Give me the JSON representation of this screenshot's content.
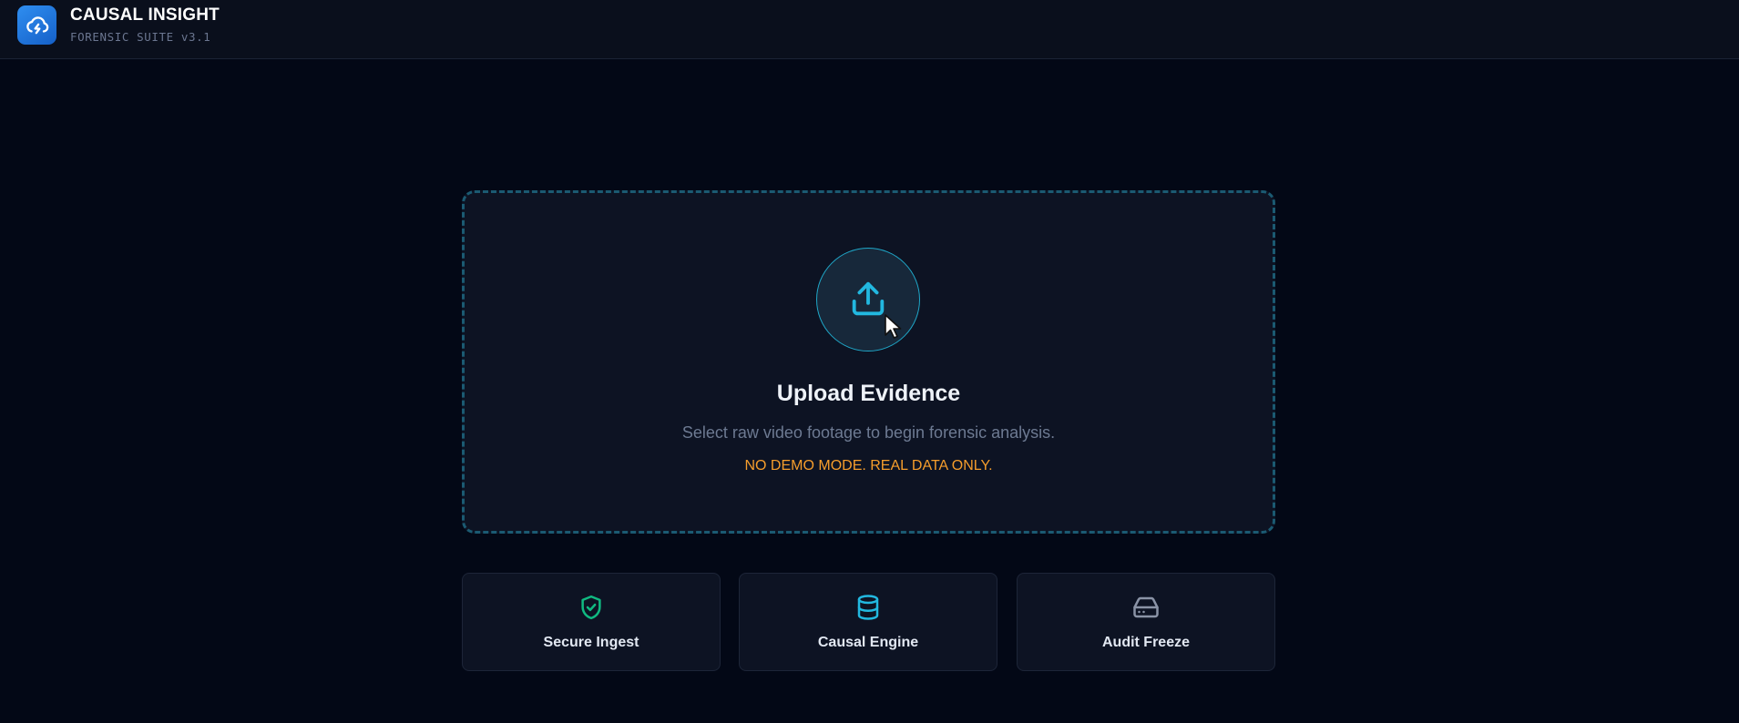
{
  "header": {
    "title": "CAUSAL INSIGHT",
    "subtitle": "FORENSIC SUITE v3.1",
    "logo_icon": "cloud-lightning-icon"
  },
  "upload": {
    "icon": "upload-icon",
    "title": "Upload Evidence",
    "description": "Select raw video footage to begin forensic analysis.",
    "warning": "NO DEMO MODE. REAL DATA ONLY."
  },
  "features": [
    {
      "label": "Secure Ingest",
      "icon": "shield-check-icon",
      "color": "#10b981"
    },
    {
      "label": "Causal Engine",
      "icon": "database-icon",
      "color": "#22b8e0"
    },
    {
      "label": "Audit Freeze",
      "icon": "hard-drive-icon",
      "color": "#8a93a6"
    }
  ],
  "colors": {
    "background": "#030816",
    "accent": "#22b8e0",
    "warning": "#f59d2c"
  }
}
